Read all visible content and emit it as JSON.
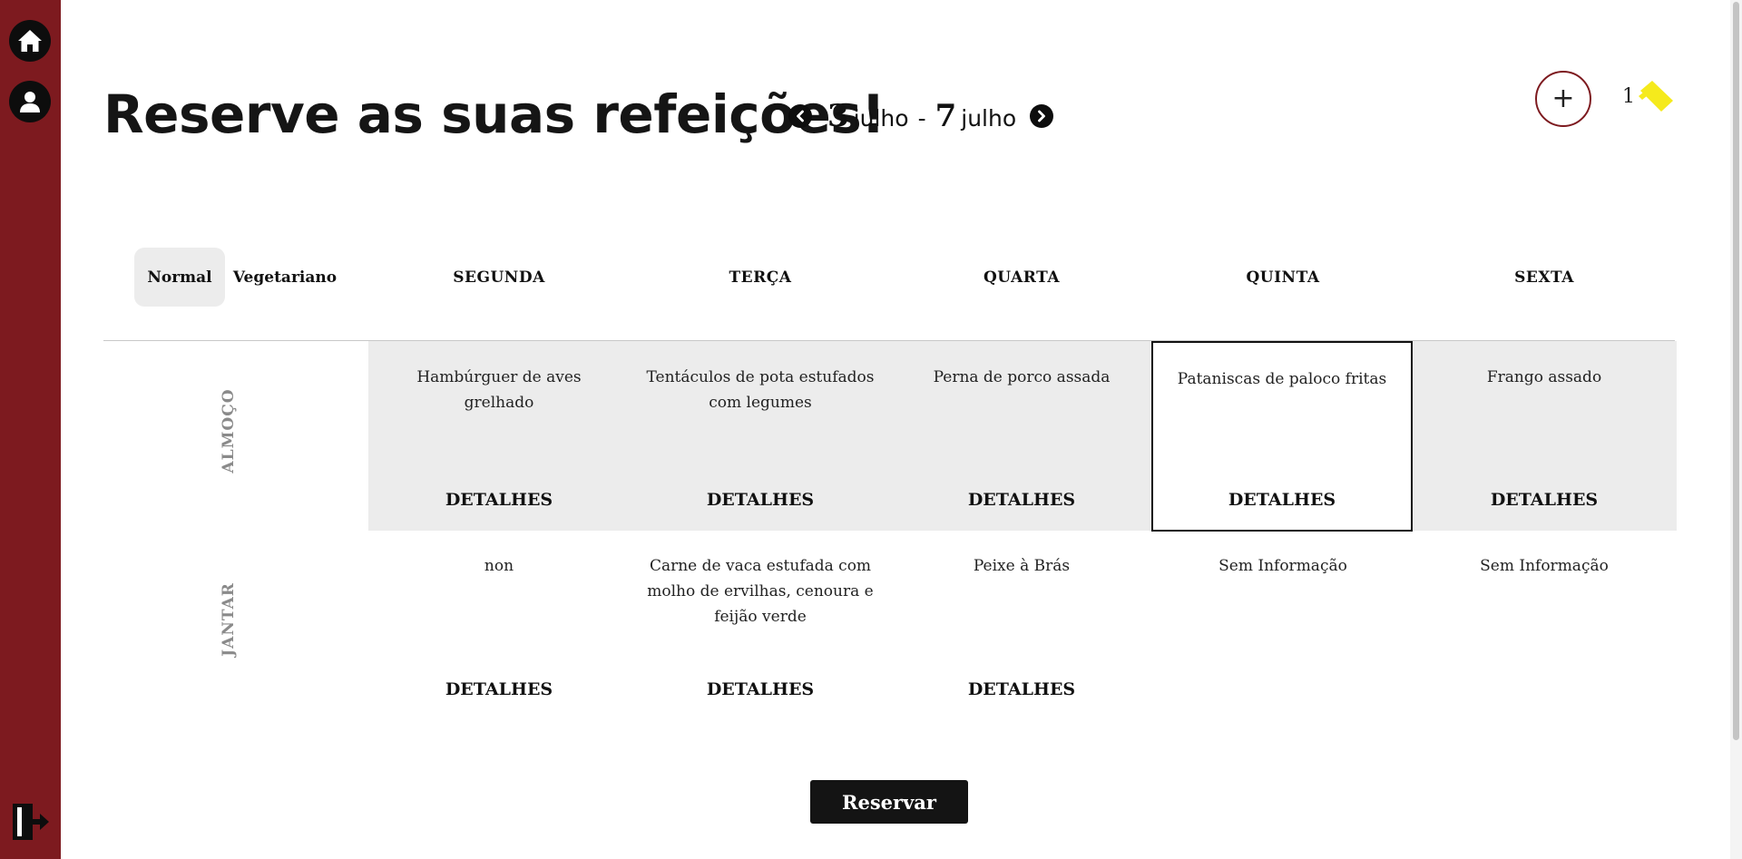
{
  "sidebar": {
    "items": [
      {
        "name": "home",
        "icon": "home-icon"
      },
      {
        "name": "profile",
        "icon": "user-icon"
      }
    ],
    "logout_icon": "logout-icon",
    "color": "#7d1a1f"
  },
  "header": {
    "title": "Reserve as suas refeições!",
    "week": {
      "start_day": "3",
      "start_month": "julho",
      "separator": "-",
      "end_day": "7",
      "end_month": "julho"
    },
    "add_label": "+",
    "ticket_count": "1",
    "ticket_icon": "ticket-icon",
    "ticket_color": "#f5ea1c"
  },
  "menu_tabs": [
    {
      "label": "Normal",
      "active": true
    },
    {
      "label": "Vegetariano",
      "active": false
    }
  ],
  "days": [
    "SEGUNDA",
    "TERÇA",
    "QUARTA",
    "QUINTA",
    "SEXTA"
  ],
  "rows": [
    {
      "label": "ALMOÇO",
      "meals": [
        {
          "name": "Hambúrguer de aves grelhado",
          "details": "DETALHES"
        },
        {
          "name": "Tentáculos de pota estufados com legumes",
          "details": "DETALHES"
        },
        {
          "name": "Perna de porco assada",
          "details": "DETALHES"
        },
        {
          "name": "Pataniscas de paloco fritas",
          "details": "DETALHES",
          "selected": true
        },
        {
          "name": "Frango assado",
          "details": "DETALHES"
        }
      ]
    },
    {
      "label": "JANTAR",
      "meals": [
        {
          "name": "non",
          "details": "DETALHES"
        },
        {
          "name": "Carne de vaca estufada com molho de ervilhas, cenoura e feijão verde",
          "details": "DETALHES"
        },
        {
          "name": "Peixe à Brás",
          "details": "DETALHES"
        },
        {
          "name": "Sem Informação",
          "details": ""
        },
        {
          "name": "Sem Informação",
          "details": ""
        }
      ]
    }
  ],
  "reserve_label": "Reservar"
}
